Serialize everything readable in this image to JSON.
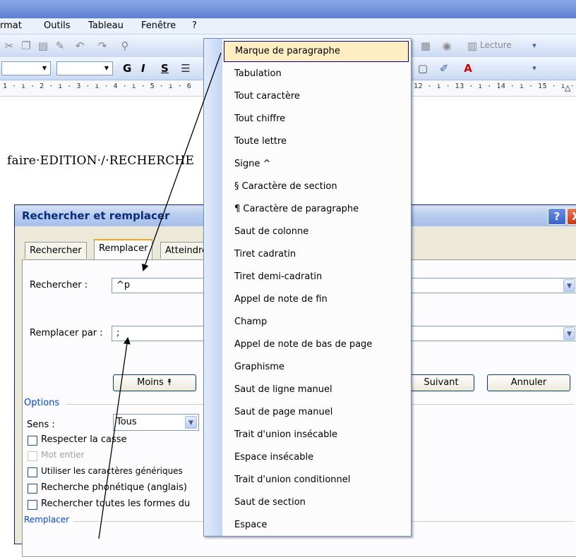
{
  "menubar": {
    "items": [
      "rmat",
      "Outils",
      "Tableau",
      "Fenêtre",
      "?"
    ]
  },
  "toolbar": {
    "reading_label": "Lecture",
    "bold": "G",
    "italic": "I",
    "underline": "S"
  },
  "ruler": {
    "left": "1 · ı · 2 · ı · 3 · ı · 4 · ı · 5 · ı · 6",
    "right": "12 · ı · 13 · ı · 14 · ı · 15 · ı ·"
  },
  "document": {
    "line": "faire·EDITION·/·RECHERCHE"
  },
  "dialog": {
    "title": "Rechercher et remplacer",
    "help": "?",
    "close": "X",
    "tabs": [
      "Rechercher",
      "Remplacer",
      "Atteindre"
    ],
    "find_label": "Rechercher :",
    "find_value": "^p",
    "replace_label": "Remplacer par :",
    "replace_value": ";",
    "less_button": "Moins ⯭",
    "next_button": "Suivant",
    "cancel_button": "Annuler",
    "options_label": "Options",
    "direction_label": "Sens :",
    "direction_value": "Tous",
    "options": [
      {
        "label": "Respecter la casse",
        "enabled": true
      },
      {
        "label": "Mot entier",
        "enabled": false
      },
      {
        "label": "Utiliser les caractères génériques",
        "enabled": true
      },
      {
        "label": "Recherche phonétique (anglais)",
        "enabled": true
      },
      {
        "label": "Rechercher toutes les formes du",
        "enabled": true
      }
    ],
    "replace_group_label": "Remplacer"
  },
  "popup_menu": {
    "items": [
      "Marque de paragraphe",
      "Tabulation",
      "Tout caractère",
      "Tout chiffre",
      "Toute lettre",
      "Signe ^",
      "§ Caractère de section",
      "¶ Caractère de paragraphe",
      "Saut de colonne",
      "Tiret cadratin",
      "Tiret demi-cadratin",
      "Appel de note de fin",
      "Champ",
      "Appel de note de bas de page",
      "Graphisme",
      "Saut de ligne manuel",
      "Saut de page manuel",
      "Trait d'union insécable",
      "Espace insécable",
      "Trait d'union conditionnel",
      "Saut de section",
      "Espace"
    ],
    "highlighted_index": 0
  }
}
